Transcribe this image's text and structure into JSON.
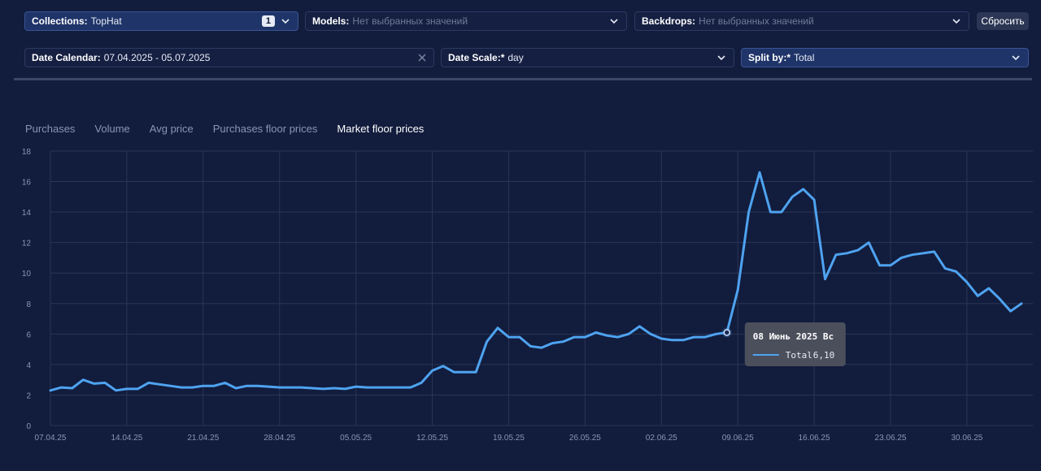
{
  "filters": {
    "collections": {
      "label": "Collections:",
      "value": "TopHat",
      "count": "1"
    },
    "models": {
      "label": "Models:",
      "placeholder": "Нет выбранных значений"
    },
    "backdrops": {
      "label": "Backdrops:",
      "placeholder": "Нет выбранных значений"
    },
    "reset_label": "Сбросить",
    "date_calendar": {
      "label": "Date Calendar:",
      "value": "07.04.2025 - 05.07.2025"
    },
    "date_scale": {
      "label": "Date Scale:*",
      "value": "day"
    },
    "split_by": {
      "label": "Split by:*",
      "value": "Total"
    }
  },
  "tabs": [
    {
      "label": "Purchases",
      "active": false
    },
    {
      "label": "Volume",
      "active": false
    },
    {
      "label": "Avg price",
      "active": false
    },
    {
      "label": "Purchases floor prices",
      "active": false
    },
    {
      "label": "Market floor prices",
      "active": true
    }
  ],
  "colors": {
    "line": "#4ea3f0",
    "grid": "#2a3555",
    "tooltip_bg": "#4b4f5c"
  },
  "tooltip": {
    "date": "08 Июнь 2025 Вс",
    "series": "Total",
    "value": "6,10",
    "point_index": 62
  },
  "chart_data": {
    "type": "line",
    "ylim": [
      0,
      18
    ],
    "yticks": [
      0,
      2,
      4,
      6,
      8,
      10,
      12,
      14,
      16,
      18
    ],
    "xticks": [
      {
        "label": "07.04.25",
        "index": 0
      },
      {
        "label": "14.04.25",
        "index": 7
      },
      {
        "label": "21.04.25",
        "index": 14
      },
      {
        "label": "28.04.25",
        "index": 21
      },
      {
        "label": "05.05.25",
        "index": 28
      },
      {
        "label": "12.05.25",
        "index": 35
      },
      {
        "label": "19.05.25",
        "index": 42
      },
      {
        "label": "26.05.25",
        "index": 49
      },
      {
        "label": "02.06.25",
        "index": 56
      },
      {
        "label": "09.06.25",
        "index": 63
      },
      {
        "label": "16.06.25",
        "index": 70
      },
      {
        "label": "23.06.25",
        "index": 77
      },
      {
        "label": "30.06.25",
        "index": 84
      }
    ],
    "series": [
      {
        "name": "Total",
        "values": [
          2.3,
          2.5,
          2.45,
          3.0,
          2.75,
          2.8,
          2.3,
          2.4,
          2.4,
          2.8,
          2.7,
          2.6,
          2.5,
          2.5,
          2.6,
          2.6,
          2.8,
          2.45,
          2.6,
          2.6,
          2.55,
          2.5,
          2.5,
          2.5,
          2.45,
          2.4,
          2.45,
          2.4,
          2.55,
          2.5,
          2.5,
          2.5,
          2.5,
          2.5,
          2.8,
          3.6,
          3.9,
          3.5,
          3.5,
          3.5,
          5.5,
          6.4,
          5.8,
          5.8,
          5.2,
          5.1,
          5.4,
          5.5,
          5.8,
          5.8,
          6.1,
          5.9,
          5.8,
          6.0,
          6.5,
          6.0,
          5.7,
          5.6,
          5.6,
          5.8,
          5.8,
          6.0,
          6.1,
          8.9,
          14.0,
          16.6,
          14.0,
          14.0,
          15.0,
          15.5,
          14.8,
          9.6,
          11.2,
          11.3,
          11.5,
          12.0,
          10.5,
          10.5,
          11.0,
          11.2,
          11.3,
          11.4,
          10.3,
          10.1,
          9.4,
          8.5,
          9.0,
          8.3,
          7.5,
          8.0
        ]
      }
    ]
  }
}
